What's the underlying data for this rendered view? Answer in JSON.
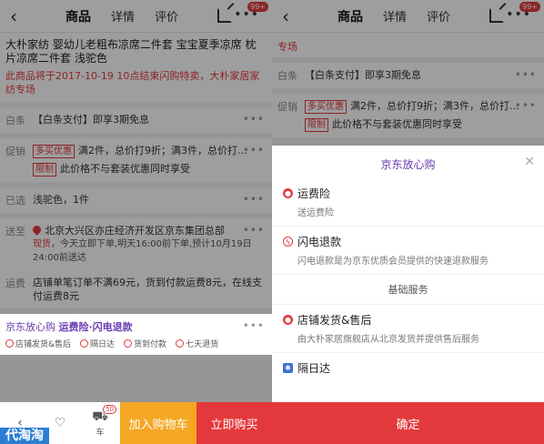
{
  "header": {
    "tabs": [
      "商品",
      "详情",
      "评价"
    ],
    "more_badge": "99+"
  },
  "product": {
    "title": "大朴家纺 婴幼儿老粗布凉席二件套 宝宝夏季凉席 枕片凉席二件套 浅驼色",
    "promo_text": "此商品将于2017-10-19 10点结束闪购特卖，大朴家居家纺专场"
  },
  "rows": {
    "baitiao_label": "白条",
    "baitiao_value": "【白条支付】即享3期免息",
    "promo_label": "促销",
    "promo_tag1": "多买优惠",
    "promo_text1": "满2件，总价打9折；满3件，总价打…",
    "promo_tag2": "限制",
    "promo_text2": "此价格不与套装优惠同时享受",
    "selected_label": "已选",
    "selected_value": "浅驼色，1件",
    "ship_label": "送至",
    "ship_address": "北京大兴区亦庄经济开发区京东集团总部",
    "ship_stock": "现货",
    "ship_detail": "，今天立即下单,明天16:00前下单,预计10月19日24:00前送达",
    "fee_label": "运费",
    "fee_value": "店铺单笔订单不满69元，货到付款运费8元，在线支付运费8元"
  },
  "service": {
    "title": "京东放心购",
    "subtitle": "运费险·闪电退款",
    "items": [
      "店铺发货&售后",
      "隔日达",
      "货到付款",
      "七天退货"
    ]
  },
  "bottom": {
    "cart_badge": "50",
    "cart_label": "车",
    "add_cart": "加入购物车",
    "buy_now": "立即购买",
    "watermark": "代淘淘"
  },
  "sheet": {
    "title": "京东放心购",
    "items": [
      {
        "title": "运费险",
        "desc": "送运费险"
      },
      {
        "title": "闪电退款",
        "desc": "闪电退款是为京东优质会员提供的快速退款服务"
      }
    ],
    "basic_label": "基础服务",
    "items2": [
      {
        "title": "店铺发货&售后",
        "desc": "由大朴家居旗舰店从北京发货并提供售后服务"
      },
      {
        "title": "隔日达",
        "desc": ""
      }
    ],
    "confirm": "确定"
  },
  "right_bg": {
    "promo_fragment": "专场",
    "baitiao_label": "白条",
    "baitiao_value": "【白条支付】即享3期免息",
    "promo_label": "促销",
    "promo_tag1": "多买优惠",
    "promo_text1": "满2件，总价打9折；满3件，总价打…",
    "promo_tag2": "限制",
    "promo_text2": "此价格不与套装优惠同时享受"
  }
}
